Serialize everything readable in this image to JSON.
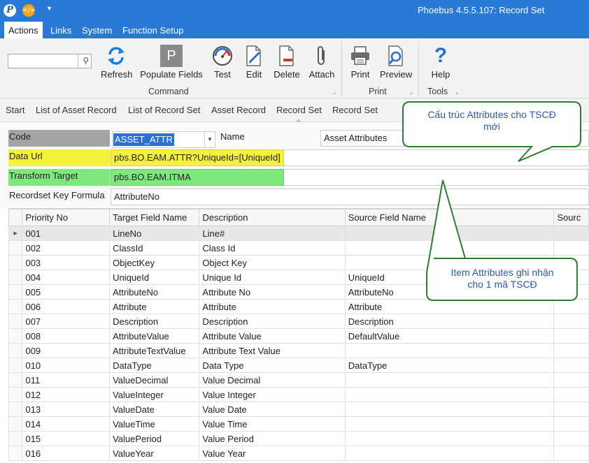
{
  "window": {
    "title": "Phoebus 4.5.5.107: Record Set",
    "app_icon_glyph": "P",
    "code_icon_glyph": "</>"
  },
  "menu": {
    "items": [
      "Actions",
      "Links",
      "System",
      "Function Setup"
    ],
    "active": "Actions"
  },
  "ribbon": {
    "search": {
      "value": "",
      "placeholder": ""
    },
    "buttons": {
      "refresh": {
        "label": "Refresh",
        "icon": "refresh-icon"
      },
      "populate": {
        "label": "Populate Fields",
        "icon": "populate-p-icon",
        "glyph": "P"
      },
      "test": {
        "label": "Test",
        "icon": "gauge-icon"
      },
      "edit": {
        "label": "Edit",
        "icon": "edit-page-icon"
      },
      "delete": {
        "label": "Delete",
        "icon": "delete-page-icon"
      },
      "attach": {
        "label": "Attach",
        "icon": "paperclip-icon"
      },
      "print": {
        "label": "Print",
        "icon": "printer-icon"
      },
      "preview": {
        "label": "Preview",
        "icon": "preview-icon"
      },
      "help": {
        "label": "Help",
        "icon": "help-icon",
        "glyph": "?"
      }
    },
    "groups": {
      "command": "Command",
      "print": "Print",
      "tools": "Tools"
    }
  },
  "breadcrumb": [
    "Start",
    "List of Asset Record",
    "List of Record Set",
    "Asset Record",
    "Record Set",
    "Record Set"
  ],
  "form": {
    "code_label": "Code",
    "code_value": "ASSET_ATTR",
    "name_label": "Name",
    "name_value": "Asset Attributes",
    "data_url_label": "Data Url",
    "data_url_value": "pbs.BO.EAM.ATTR?UniqueId=[UniqueId]",
    "transform_label": "Transform Target",
    "transform_value": "pbs.BO.EAM.ITMA",
    "key_formula_label": "Recordset Key Formula",
    "key_formula_value": "AttributeNo"
  },
  "grid": {
    "columns": [
      "Priority No",
      "Target Field Name",
      "Description",
      "Source Field Name",
      "Sourc"
    ],
    "rows": [
      [
        "001",
        "LineNo",
        "Line#",
        "",
        ""
      ],
      [
        "002",
        "ClassId",
        "Class Id",
        "",
        ""
      ],
      [
        "003",
        "ObjectKey",
        "Object Key",
        "",
        ""
      ],
      [
        "004",
        "UniqueId",
        "Unique Id",
        "UniqueId",
        ""
      ],
      [
        "005",
        "AttributeNo",
        "Attribute No",
        "AttributeNo",
        ""
      ],
      [
        "006",
        "Attribute",
        "Attribute",
        "Attribute",
        ""
      ],
      [
        "007",
        "Description",
        "Description",
        "Description",
        ""
      ],
      [
        "008",
        "AttributeValue",
        "Attribute Value",
        "DefaultValue",
        ""
      ],
      [
        "009",
        "AttributeTextValue",
        "Attribute Text Value",
        "",
        ""
      ],
      [
        "010",
        "DataType",
        "Data Type",
        "DataType",
        ""
      ],
      [
        "011",
        "ValueDecimal",
        "Value Decimal",
        "",
        ""
      ],
      [
        "012",
        "ValueInteger",
        "Value Integer",
        "",
        ""
      ],
      [
        "013",
        "ValueDate",
        "Value Date",
        "",
        ""
      ],
      [
        "014",
        "ValueTime",
        "Value Time",
        "",
        ""
      ],
      [
        "015",
        "ValuePeriod",
        "Value Period",
        "",
        ""
      ],
      [
        "016",
        "ValueYear",
        "Value Year",
        "",
        ""
      ]
    ],
    "selected_row_marker": "▶"
  },
  "callouts": {
    "top": {
      "line1": "Cấu trúc Attributes cho TSCĐ",
      "line2": "mới"
    },
    "bottom": {
      "line1": "Item Attributes ghi nhận",
      "line2": "cho 1 mã TSCĐ"
    }
  },
  "colors": {
    "brand_blue": "#2b79d6",
    "highlight_yellow": "#f4f23a",
    "highlight_green": "#7ee87e",
    "callout_border": "#2e7d32",
    "callout_text": "#2d5aa6"
  }
}
